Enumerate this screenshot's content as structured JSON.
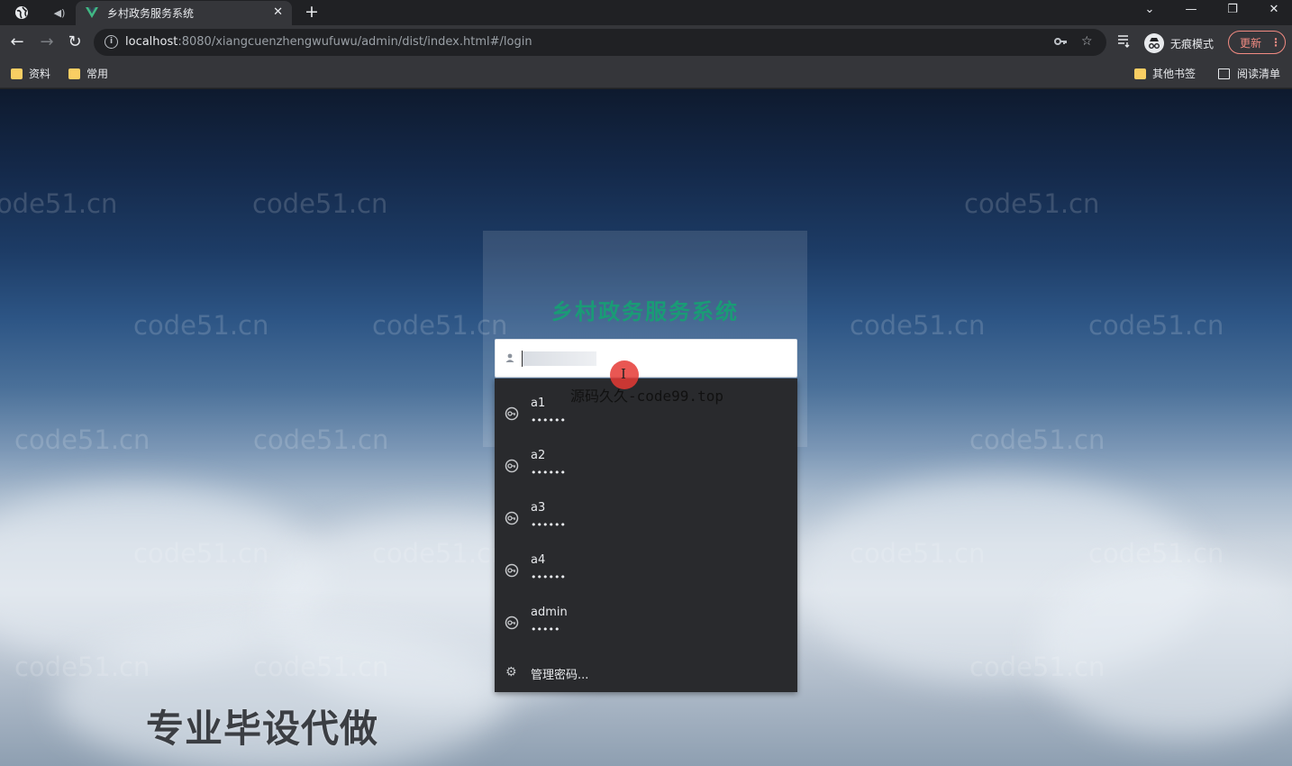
{
  "browser": {
    "tab_title": "乡村政务服务系统",
    "tab_close": "✕",
    "new_tab": "+",
    "window_controls": [
      "⌄",
      "—",
      "❐",
      "✕"
    ],
    "nav": {
      "back": "←",
      "forward": "→",
      "reload": "↻"
    },
    "url_host": "localhost",
    "url_path": ":8080/xiangcuenzhengwufuwu/admin/dist/index.html#/login",
    "incognito_label": "无痕模式",
    "update_label": "更新",
    "update_menu": "⋮",
    "bookmarks_left": [
      "资料",
      "常用"
    ],
    "bookmarks_right": {
      "other": "其他书签",
      "reading_list": "阅读清单"
    },
    "accent_update": "#f28b82",
    "folder_color": "#f9ce63"
  },
  "page": {
    "system_title": "乡村政务服务系统",
    "username_field": {
      "value": "",
      "placeholder": ""
    },
    "title_color": "#1a9b76"
  },
  "autofill": {
    "items": [
      {
        "username": "a1",
        "password": "••••••"
      },
      {
        "username": "a2",
        "password": "••••••"
      },
      {
        "username": "a3",
        "password": "••••••"
      },
      {
        "username": "a4",
        "password": "••••••"
      },
      {
        "username": "admin",
        "password": "•••••"
      }
    ],
    "manage_label": "管理密码..."
  },
  "overlays": {
    "watermark": "code51.cn",
    "source_text": "源码久久-code99.top",
    "promo_text": "专业毕设代做",
    "cursor_glyph": "I"
  }
}
